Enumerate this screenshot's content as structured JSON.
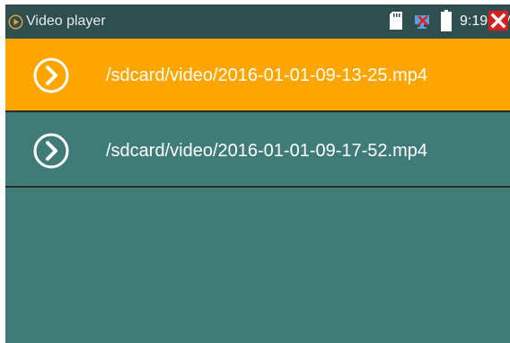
{
  "statusbar": {
    "title": "Video player",
    "time": "9:19 AM",
    "icons": [
      "play-circle-icon",
      "sd-card-icon",
      "network-error-icon",
      "battery-icon",
      "close-icon"
    ]
  },
  "files": [
    {
      "path": "/sdcard/video/2016-01-01-09-13-25.mp4",
      "selected": true,
      "icon": "play-arrow-icon"
    },
    {
      "path": "/sdcard/video/2016-01-01-09-17-52.mp4",
      "selected": false,
      "icon": "play-arrow-icon"
    }
  ],
  "colors": {
    "accent_selected": "#ffa500",
    "background": "#3f7c78",
    "statusbar": "#2f4f4f",
    "close": "#d81f1f"
  }
}
